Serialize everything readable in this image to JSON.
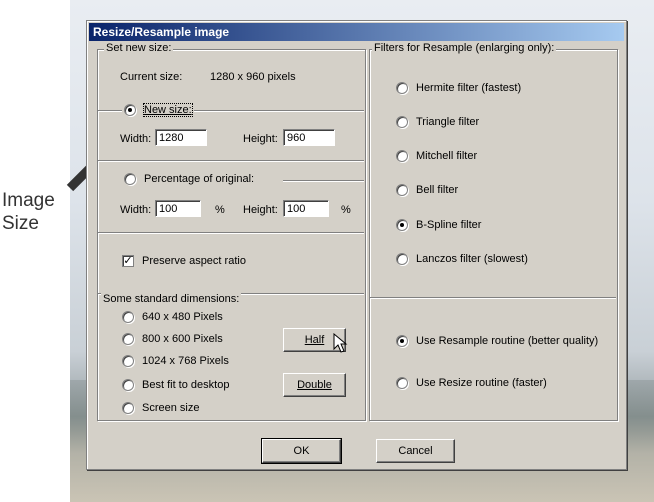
{
  "annotation": {
    "line1": "Image",
    "line2": "Size"
  },
  "dialog": {
    "title": "Resize/Resample image",
    "set_new_size": {
      "label": "Set new size:",
      "current_size_label": "Current size:",
      "current_size_value": "1280  x  960  pixels",
      "new_size_label": "New size:",
      "width_label": "Width:",
      "width_value": "1280",
      "height_label": "Height:",
      "height_value": "960",
      "percentage_label": "Percentage of original:",
      "pct_width_label": "Width:",
      "pct_width_value": "100",
      "pct_width_unit": "%",
      "pct_height_label": "Height:",
      "pct_height_value": "100",
      "pct_height_unit": "%",
      "preserve_label": "Preserve aspect ratio",
      "preserve_checked": true
    },
    "standard": {
      "label": "Some standard dimensions:",
      "options": [
        "640 x 480 Pixels",
        "800 x 600 Pixels",
        "1024 x 768 Pixels",
        "Best fit to desktop",
        "Screen size"
      ],
      "half_label": "Half",
      "double_label": "Double"
    },
    "filters": {
      "label": "Filters for Resample (enlarging only):",
      "options": [
        "Hermite filter (fastest)",
        "Triangle filter",
        "Mitchell filter",
        "Bell filter",
        "B-Spline filter",
        "Lanczos filter (slowest)"
      ],
      "selected_index": 4
    },
    "routine": {
      "resample_label": "Use Resample routine (better quality)",
      "resize_label": "Use Resize routine (faster)",
      "selected": "resample"
    },
    "ok_label": "OK",
    "cancel_label": "Cancel"
  }
}
